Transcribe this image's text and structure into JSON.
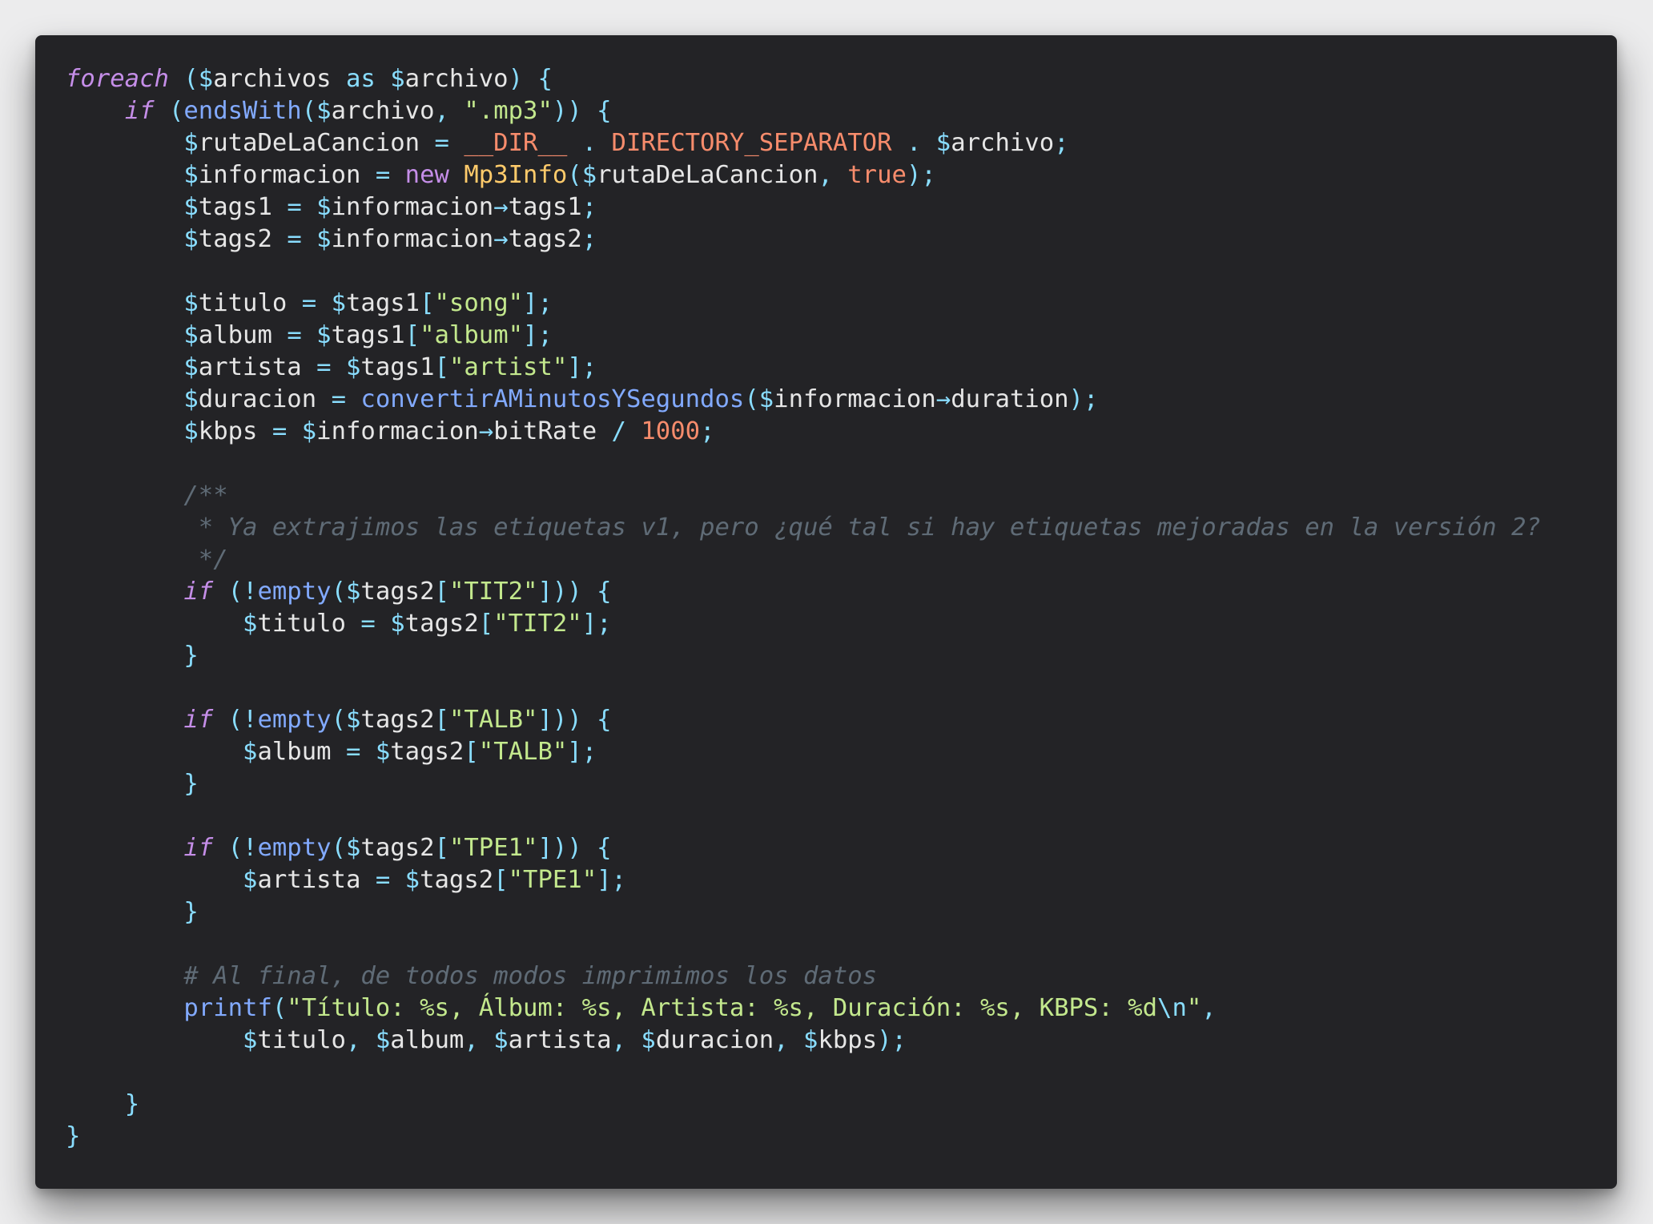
{
  "editor": {
    "language": "php",
    "theme_colors": {
      "background": "#232326",
      "keyword": "#c58ee8",
      "operator": "#89ddff",
      "string": "#c3e88d",
      "function": "#82aaff",
      "class": "#ffcb6b",
      "constant": "#f78c6c",
      "comment": "#5f6b76",
      "text": "#e6e6e6"
    },
    "lines": [
      [
        [
          "keyword",
          "foreach"
        ],
        [
          "plain",
          " "
        ],
        [
          "punct",
          "("
        ],
        [
          "dollar",
          "$"
        ],
        [
          "var",
          "archivos"
        ],
        [
          "plain",
          " "
        ],
        [
          "operator",
          "as"
        ],
        [
          "plain",
          " "
        ],
        [
          "dollar",
          "$"
        ],
        [
          "var",
          "archivo"
        ],
        [
          "punct",
          ")"
        ],
        [
          "plain",
          " "
        ],
        [
          "punct",
          "{"
        ]
      ],
      [
        [
          "plain",
          "    "
        ],
        [
          "keyword",
          "if"
        ],
        [
          "plain",
          " "
        ],
        [
          "punct",
          "("
        ],
        [
          "func",
          "endsWith"
        ],
        [
          "punct",
          "("
        ],
        [
          "dollar",
          "$"
        ],
        [
          "var",
          "archivo"
        ],
        [
          "punct",
          ","
        ],
        [
          "plain",
          " "
        ],
        [
          "string",
          "\".mp3\""
        ],
        [
          "punct",
          "))"
        ],
        [
          "plain",
          " "
        ],
        [
          "punct",
          "{"
        ]
      ],
      [
        [
          "plain",
          "        "
        ],
        [
          "dollar",
          "$"
        ],
        [
          "var",
          "rutaDeLaCancion"
        ],
        [
          "plain",
          " "
        ],
        [
          "operator",
          "="
        ],
        [
          "plain",
          " "
        ],
        [
          "const",
          "__DIR__"
        ],
        [
          "plain",
          " "
        ],
        [
          "operator",
          "."
        ],
        [
          "plain",
          " "
        ],
        [
          "const",
          "DIRECTORY_SEPARATOR"
        ],
        [
          "plain",
          " "
        ],
        [
          "operator",
          "."
        ],
        [
          "plain",
          " "
        ],
        [
          "dollar",
          "$"
        ],
        [
          "var",
          "archivo"
        ],
        [
          "punct",
          ";"
        ]
      ],
      [
        [
          "plain",
          "        "
        ],
        [
          "dollar",
          "$"
        ],
        [
          "var",
          "informacion"
        ],
        [
          "plain",
          " "
        ],
        [
          "operator",
          "="
        ],
        [
          "plain",
          " "
        ],
        [
          "new",
          "new"
        ],
        [
          "plain",
          " "
        ],
        [
          "class",
          "Mp3Info"
        ],
        [
          "punct",
          "("
        ],
        [
          "dollar",
          "$"
        ],
        [
          "var",
          "rutaDeLaCancion"
        ],
        [
          "punct",
          ","
        ],
        [
          "plain",
          " "
        ],
        [
          "const",
          "true"
        ],
        [
          "punct",
          ");"
        ]
      ],
      [
        [
          "plain",
          "        "
        ],
        [
          "dollar",
          "$"
        ],
        [
          "var",
          "tags1"
        ],
        [
          "plain",
          " "
        ],
        [
          "operator",
          "="
        ],
        [
          "plain",
          " "
        ],
        [
          "dollar",
          "$"
        ],
        [
          "var",
          "informacion"
        ],
        [
          "operator",
          "→"
        ],
        [
          "prop",
          "tags1"
        ],
        [
          "punct",
          ";"
        ]
      ],
      [
        [
          "plain",
          "        "
        ],
        [
          "dollar",
          "$"
        ],
        [
          "var",
          "tags2"
        ],
        [
          "plain",
          " "
        ],
        [
          "operator",
          "="
        ],
        [
          "plain",
          " "
        ],
        [
          "dollar",
          "$"
        ],
        [
          "var",
          "informacion"
        ],
        [
          "operator",
          "→"
        ],
        [
          "prop",
          "tags2"
        ],
        [
          "punct",
          ";"
        ]
      ],
      [
        [
          "plain",
          ""
        ]
      ],
      [
        [
          "plain",
          "        "
        ],
        [
          "dollar",
          "$"
        ],
        [
          "var",
          "titulo"
        ],
        [
          "plain",
          " "
        ],
        [
          "operator",
          "="
        ],
        [
          "plain",
          " "
        ],
        [
          "dollar",
          "$"
        ],
        [
          "var",
          "tags1"
        ],
        [
          "punct",
          "["
        ],
        [
          "string",
          "\"song\""
        ],
        [
          "punct",
          "];"
        ]
      ],
      [
        [
          "plain",
          "        "
        ],
        [
          "dollar",
          "$"
        ],
        [
          "var",
          "album"
        ],
        [
          "plain",
          " "
        ],
        [
          "operator",
          "="
        ],
        [
          "plain",
          " "
        ],
        [
          "dollar",
          "$"
        ],
        [
          "var",
          "tags1"
        ],
        [
          "punct",
          "["
        ],
        [
          "string",
          "\"album\""
        ],
        [
          "punct",
          "];"
        ]
      ],
      [
        [
          "plain",
          "        "
        ],
        [
          "dollar",
          "$"
        ],
        [
          "var",
          "artista"
        ],
        [
          "plain",
          " "
        ],
        [
          "operator",
          "="
        ],
        [
          "plain",
          " "
        ],
        [
          "dollar",
          "$"
        ],
        [
          "var",
          "tags1"
        ],
        [
          "punct",
          "["
        ],
        [
          "string",
          "\"artist\""
        ],
        [
          "punct",
          "];"
        ]
      ],
      [
        [
          "plain",
          "        "
        ],
        [
          "dollar",
          "$"
        ],
        [
          "var",
          "duracion"
        ],
        [
          "plain",
          " "
        ],
        [
          "operator",
          "="
        ],
        [
          "plain",
          " "
        ],
        [
          "func",
          "convertirAMinutosYSegundos"
        ],
        [
          "punct",
          "("
        ],
        [
          "dollar",
          "$"
        ],
        [
          "var",
          "informacion"
        ],
        [
          "operator",
          "→"
        ],
        [
          "prop",
          "duration"
        ],
        [
          "punct",
          ");"
        ]
      ],
      [
        [
          "plain",
          "        "
        ],
        [
          "dollar",
          "$"
        ],
        [
          "var",
          "kbps"
        ],
        [
          "plain",
          " "
        ],
        [
          "operator",
          "="
        ],
        [
          "plain",
          " "
        ],
        [
          "dollar",
          "$"
        ],
        [
          "var",
          "informacion"
        ],
        [
          "operator",
          "→"
        ],
        [
          "prop",
          "bitRate"
        ],
        [
          "plain",
          " "
        ],
        [
          "operator",
          "/"
        ],
        [
          "plain",
          " "
        ],
        [
          "number",
          "1000"
        ],
        [
          "punct",
          ";"
        ]
      ],
      [
        [
          "plain",
          ""
        ]
      ],
      [
        [
          "plain",
          "        "
        ],
        [
          "comment",
          "/**"
        ]
      ],
      [
        [
          "plain",
          "         "
        ],
        [
          "comment",
          "* Ya extrajimos las etiquetas v1, pero ¿qué tal si hay etiquetas mejoradas en la versión 2?"
        ]
      ],
      [
        [
          "plain",
          "         "
        ],
        [
          "comment",
          "*/"
        ]
      ],
      [
        [
          "plain",
          "        "
        ],
        [
          "keyword",
          "if"
        ],
        [
          "plain",
          " "
        ],
        [
          "punct",
          "("
        ],
        [
          "operator",
          "!"
        ],
        [
          "func",
          "empty"
        ],
        [
          "punct",
          "("
        ],
        [
          "dollar",
          "$"
        ],
        [
          "var",
          "tags2"
        ],
        [
          "punct",
          "["
        ],
        [
          "string",
          "\"TIT2\""
        ],
        [
          "punct",
          "]))"
        ],
        [
          "plain",
          " "
        ],
        [
          "punct",
          "{"
        ]
      ],
      [
        [
          "plain",
          "            "
        ],
        [
          "dollar",
          "$"
        ],
        [
          "var",
          "titulo"
        ],
        [
          "plain",
          " "
        ],
        [
          "operator",
          "="
        ],
        [
          "plain",
          " "
        ],
        [
          "dollar",
          "$"
        ],
        [
          "var",
          "tags2"
        ],
        [
          "punct",
          "["
        ],
        [
          "string",
          "\"TIT2\""
        ],
        [
          "punct",
          "];"
        ]
      ],
      [
        [
          "plain",
          "        "
        ],
        [
          "punct",
          "}"
        ]
      ],
      [
        [
          "plain",
          ""
        ]
      ],
      [
        [
          "plain",
          "        "
        ],
        [
          "keyword",
          "if"
        ],
        [
          "plain",
          " "
        ],
        [
          "punct",
          "("
        ],
        [
          "operator",
          "!"
        ],
        [
          "func",
          "empty"
        ],
        [
          "punct",
          "("
        ],
        [
          "dollar",
          "$"
        ],
        [
          "var",
          "tags2"
        ],
        [
          "punct",
          "["
        ],
        [
          "string",
          "\"TALB\""
        ],
        [
          "punct",
          "]))"
        ],
        [
          "plain",
          " "
        ],
        [
          "punct",
          "{"
        ]
      ],
      [
        [
          "plain",
          "            "
        ],
        [
          "dollar",
          "$"
        ],
        [
          "var",
          "album"
        ],
        [
          "plain",
          " "
        ],
        [
          "operator",
          "="
        ],
        [
          "plain",
          " "
        ],
        [
          "dollar",
          "$"
        ],
        [
          "var",
          "tags2"
        ],
        [
          "punct",
          "["
        ],
        [
          "string",
          "\"TALB\""
        ],
        [
          "punct",
          "];"
        ]
      ],
      [
        [
          "plain",
          "        "
        ],
        [
          "punct",
          "}"
        ]
      ],
      [
        [
          "plain",
          ""
        ]
      ],
      [
        [
          "plain",
          "        "
        ],
        [
          "keyword",
          "if"
        ],
        [
          "plain",
          " "
        ],
        [
          "punct",
          "("
        ],
        [
          "operator",
          "!"
        ],
        [
          "func",
          "empty"
        ],
        [
          "punct",
          "("
        ],
        [
          "dollar",
          "$"
        ],
        [
          "var",
          "tags2"
        ],
        [
          "punct",
          "["
        ],
        [
          "string",
          "\"TPE1\""
        ],
        [
          "punct",
          "]))"
        ],
        [
          "plain",
          " "
        ],
        [
          "punct",
          "{"
        ]
      ],
      [
        [
          "plain",
          "            "
        ],
        [
          "dollar",
          "$"
        ],
        [
          "var",
          "artista"
        ],
        [
          "plain",
          " "
        ],
        [
          "operator",
          "="
        ],
        [
          "plain",
          " "
        ],
        [
          "dollar",
          "$"
        ],
        [
          "var",
          "tags2"
        ],
        [
          "punct",
          "["
        ],
        [
          "string",
          "\"TPE1\""
        ],
        [
          "punct",
          "];"
        ]
      ],
      [
        [
          "plain",
          "        "
        ],
        [
          "punct",
          "}"
        ]
      ],
      [
        [
          "plain",
          ""
        ]
      ],
      [
        [
          "plain",
          "        "
        ],
        [
          "comment",
          "# Al final, de todos modos imprimimos los datos"
        ]
      ],
      [
        [
          "plain",
          "        "
        ],
        [
          "func",
          "printf"
        ],
        [
          "punct",
          "("
        ],
        [
          "string",
          "\"Título: %s, Álbum: %s, Artista: %s, Duración: %s, KBPS: %d"
        ],
        [
          "escape",
          "\\n"
        ],
        [
          "string",
          "\""
        ],
        [
          "punct",
          ","
        ]
      ],
      [
        [
          "plain",
          "            "
        ],
        [
          "dollar",
          "$"
        ],
        [
          "var",
          "titulo"
        ],
        [
          "punct",
          ","
        ],
        [
          "plain",
          " "
        ],
        [
          "dollar",
          "$"
        ],
        [
          "var",
          "album"
        ],
        [
          "punct",
          ","
        ],
        [
          "plain",
          " "
        ],
        [
          "dollar",
          "$"
        ],
        [
          "var",
          "artista"
        ],
        [
          "punct",
          ","
        ],
        [
          "plain",
          " "
        ],
        [
          "dollar",
          "$"
        ],
        [
          "var",
          "duracion"
        ],
        [
          "punct",
          ","
        ],
        [
          "plain",
          " "
        ],
        [
          "dollar",
          "$"
        ],
        [
          "var",
          "kbps"
        ],
        [
          "punct",
          ");"
        ]
      ],
      [
        [
          "plain",
          ""
        ]
      ],
      [
        [
          "plain",
          "    "
        ],
        [
          "punct",
          "}"
        ]
      ],
      [
        [
          "punct",
          "}"
        ]
      ]
    ]
  }
}
